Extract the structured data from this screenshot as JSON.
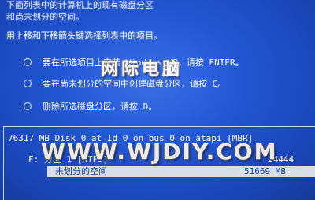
{
  "intro": {
    "line1": "下面列表中的计算机上的现有磁盘分区",
    "line2": "和尚未划分的空间。",
    "line3": "用上移和下移箭头键选择列表中的项目。"
  },
  "options": [
    {
      "text": "要在所选项目上安装 Windows XP，请按 ENTER。"
    },
    {
      "text": "要在尚未划分的空间中创建磁盘分区，请按 C。"
    },
    {
      "text": "删除所选磁盘分区，请按 D。"
    }
  ],
  "watermark": {
    "chinese": "网际电脑",
    "url": "WWW.WJDIY.COM"
  },
  "disk": {
    "header": "76317 MB Disk 0 at Id 0 on bus 0 on atapi [MBR]",
    "partition": "F:   分区 1 [NTFS]",
    "partition_size": "24444",
    "unpartitioned_label": "未划分的空间",
    "unpartitioned_size": "51669 MB"
  }
}
